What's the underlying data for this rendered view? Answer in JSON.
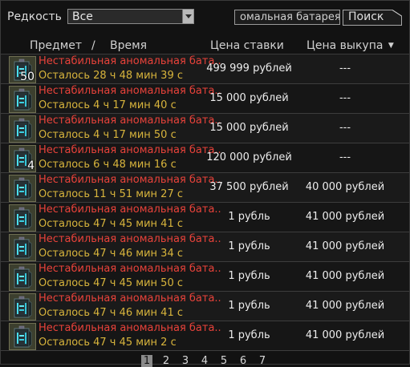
{
  "filters": {
    "rarity_label": "Редкость",
    "rarity_value": "Все",
    "search_value": "омальная батарея",
    "search_button": "Поиск"
  },
  "columns": {
    "item": "Предмет",
    "slash": "/",
    "time": "Время",
    "bid": "Цена ставки",
    "buyout": "Цена выкупа"
  },
  "rows": [
    {
      "name": "Нестабильная аномальная бата..",
      "time": "Осталось 28 ч 48 мин 39 с",
      "bid": "499 999 рублей",
      "buyout": "---",
      "qty": "50"
    },
    {
      "name": "Нестабильная аномальная бата..",
      "time": "Осталось 4 ч 17 мин 40 с",
      "bid": "15 000 рублей",
      "buyout": "---",
      "qty": ""
    },
    {
      "name": "Нестабильная аномальная бата..",
      "time": "Осталось 4 ч 17 мин 50 с",
      "bid": "15 000 рублей",
      "buyout": "---",
      "qty": ""
    },
    {
      "name": "Нестабильная аномальная бата..",
      "time": "Осталось 6 ч 48 мин 16 с",
      "bid": "120 000 рублей",
      "buyout": "---",
      "qty": "4"
    },
    {
      "name": "Нестабильная аномальная бата..",
      "time": "Осталось 11 ч 51 мин 27 с",
      "bid": "37 500 рублей",
      "buyout": "40 000 рублей",
      "qty": ""
    },
    {
      "name": "Нестабильная аномальная бата..",
      "time": "Осталось 47 ч 45 мин 41 с",
      "bid": "1 рубль",
      "buyout": "41 000 рублей",
      "qty": ""
    },
    {
      "name": "Нестабильная аномальная бата..",
      "time": "Осталось 47 ч 46 мин 34 с",
      "bid": "1 рубль",
      "buyout": "41 000 рублей",
      "qty": ""
    },
    {
      "name": "Нестабильная аномальная бата..",
      "time": "Осталось 47 ч 45 мин 50 с",
      "bid": "1 рубль",
      "buyout": "41 000 рублей",
      "qty": ""
    },
    {
      "name": "Нестабильная аномальная бата..",
      "time": "Осталось 47 ч 46 мин 41 с",
      "bid": "1 рубль",
      "buyout": "41 000 рублей",
      "qty": ""
    },
    {
      "name": "Нестабильная аномальная бата..",
      "time": "Осталось 47 ч 45 мин 2 с",
      "bid": "1 рубль",
      "buyout": "41 000 рублей",
      "qty": ""
    }
  ],
  "pagination": {
    "pages": [
      "1",
      "2",
      "3",
      "4",
      "5",
      "6",
      "7"
    ],
    "current": "1"
  },
  "colors": {
    "item_name": "#e8423a",
    "time_left": "#d8b43c",
    "background": "#121212"
  },
  "icons": {
    "item": "battery-artifact-icon",
    "sort": "sort-desc-icon"
  }
}
